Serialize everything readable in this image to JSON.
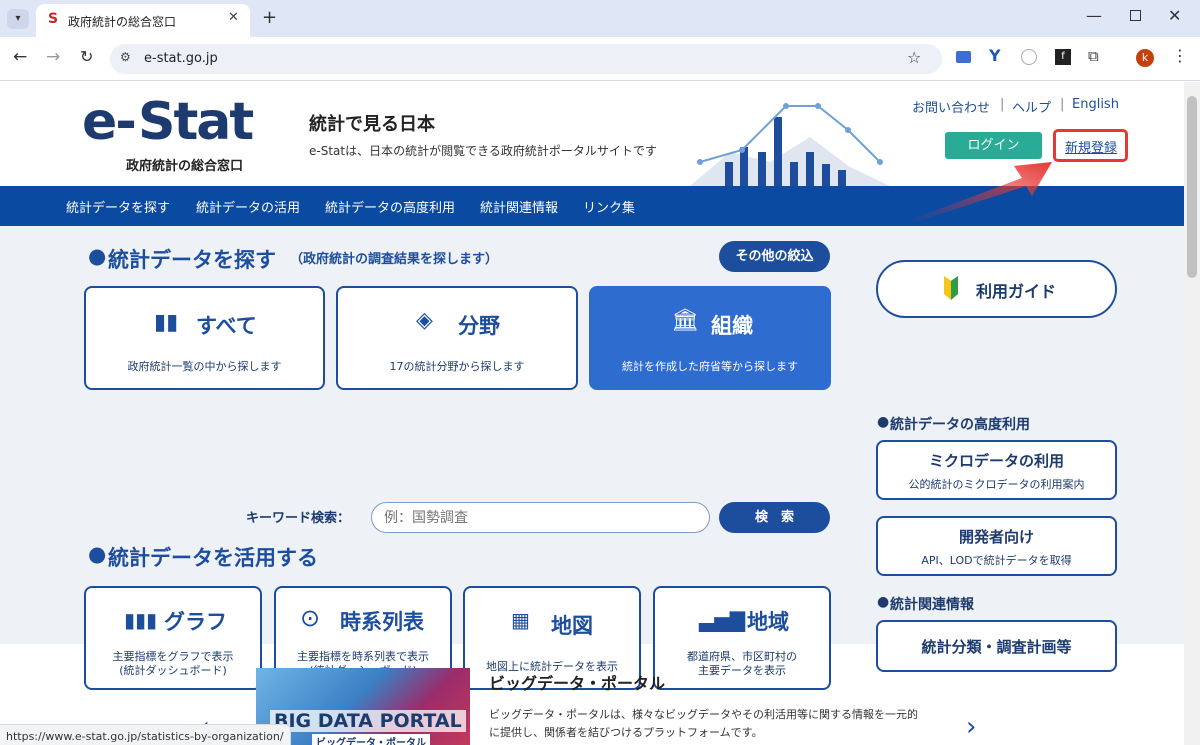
{
  "browser": {
    "tab_title": "政府統計の総合窓口",
    "tab_favicon": "S",
    "url": "e-stat.go.jp",
    "status_url": "https://www.e-stat.go.jp/statistics-by-organization/",
    "profile_initial": "k"
  },
  "header": {
    "logo_text_e": "e-",
    "logo_text_stat": "Stat",
    "logo_sub": "政府統計の総合窓口",
    "tagline_title": "統計で見る日本",
    "tagline_sub": "e-Statは、日本の統計が閲覧できる政府統計ポータルサイトです",
    "links": [
      "お問い合わせ",
      "ヘルプ",
      "English"
    ],
    "login_label": "ログイン",
    "register_label": "新規登録"
  },
  "nav": {
    "items": [
      "統計データを探す",
      "統計データの活用",
      "統計データの高度利用",
      "統計関連情報",
      "リンク集"
    ]
  },
  "search_section": {
    "title": "統計データを探す",
    "subtitle": "（政府統計の調査結果を探します）",
    "filter_button": "その他の絞込",
    "cards": [
      {
        "title": "すべて",
        "sub": "政府統計一覧の中から探します"
      },
      {
        "title": "分野",
        "sub": "17の統計分野から探します"
      },
      {
        "title": "組織",
        "sub": "統計を作成した府省等から探します"
      }
    ],
    "keyword_label": "キーワード検索：",
    "keyword_placeholder": "例：国勢調査",
    "search_button": "検　索"
  },
  "use_section": {
    "title": "統計データを活用する",
    "cards": [
      {
        "title": "グラフ",
        "sub1": "主要指標をグラフで表示",
        "sub2": "(統計ダッシュボード)"
      },
      {
        "title": "時系列表",
        "sub1": "主要指標を時系列表で表示",
        "sub2": "(統計ダッシュボード)"
      },
      {
        "title": "地図",
        "sub1": "地図上に統計データを表示",
        "sub2": ""
      },
      {
        "title": "地域",
        "sub1": "都道府県、市区町村の",
        "sub2": "主要データを表示"
      }
    ]
  },
  "right": {
    "guide": "利用ガイド",
    "advanced_title": "統計データの高度利用",
    "micro_title": "ミクロデータの利用",
    "micro_sub": "公的統計のミクロデータの利用案内",
    "dev_title": "開発者向け",
    "dev_sub": "API、LODで統計データを取得",
    "related_title": "統計関連情報",
    "classification": "統計分類・調査計画等"
  },
  "bigdata": {
    "banner_title": "BIG DATA PORTAL",
    "banner_sub": "ビッグデータ・ポータル",
    "title": "ビッグデータ・ポータル",
    "desc1": "ビッグデータ・ポータルは、様々なビッグデータやその利活用等に関する情報を一元的",
    "desc2": "に提供し、関係者を結びつけるプラットフォームです。"
  },
  "colors": {
    "brand_blue": "#0b4aa1",
    "accent_red": "#e53935",
    "login_green": "#2aab95"
  }
}
